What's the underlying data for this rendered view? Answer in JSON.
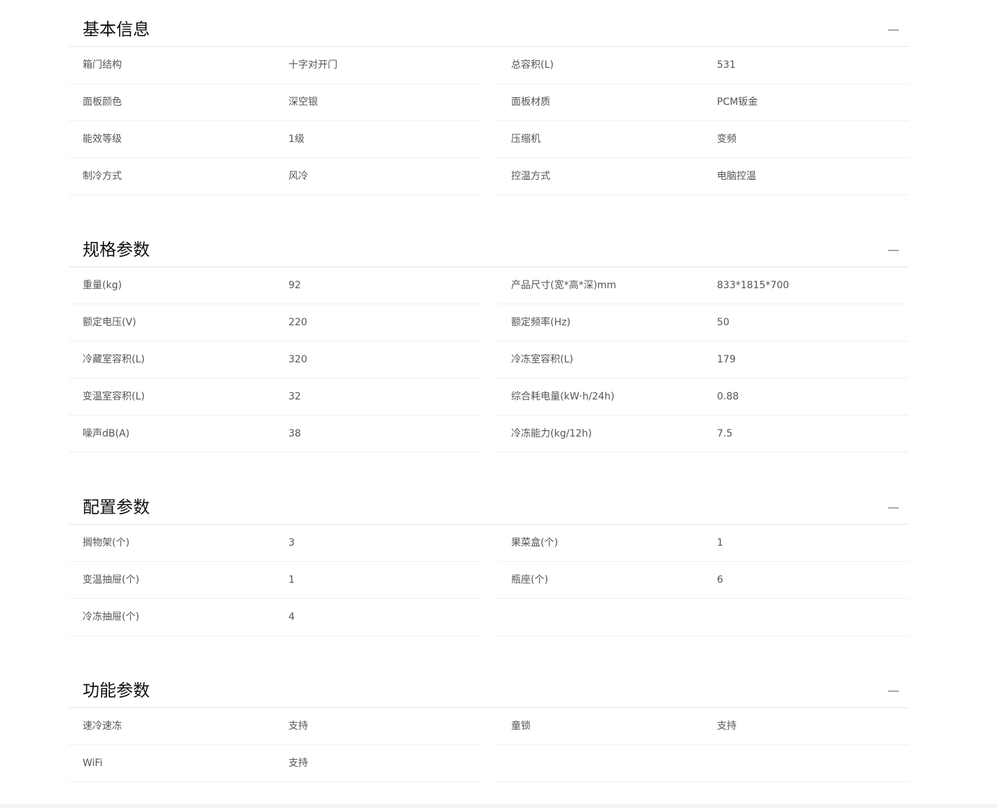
{
  "sections": [
    {
      "title": "基本信息",
      "rows": [
        [
          "箱门结构",
          "十字对开门",
          "总容积(L)",
          "531"
        ],
        [
          "面板颜色",
          "深空银",
          "面板材质",
          "PCM钣金"
        ],
        [
          "能效等级",
          "1级",
          "压缩机",
          "变频"
        ],
        [
          "制冷方式",
          "风冷",
          "控温方式",
          "电脑控温"
        ]
      ]
    },
    {
      "title": "规格参数",
      "rows": [
        [
          "重量(kg)",
          "92",
          "产品尺寸(宽*高*深)mm",
          "833*1815*700"
        ],
        [
          "额定电压(V)",
          "220",
          "额定频率(Hz)",
          "50"
        ],
        [
          "冷藏室容积(L)",
          "320",
          "冷冻室容积(L)",
          "179"
        ],
        [
          "变温室容积(L)",
          "32",
          "综合耗电量(kW·h/24h)",
          "0.88"
        ],
        [
          "噪声dB(A)",
          "38",
          "冷冻能力(kg/12h)",
          "7.5"
        ]
      ]
    },
    {
      "title": "配置参数",
      "rows": [
        [
          "搁物架(个)",
          "3",
          "果菜盒(个)",
          "1"
        ],
        [
          "变温抽屉(个)",
          "1",
          "瓶座(个)",
          "6"
        ],
        [
          "冷冻抽屉(个)",
          "4",
          "",
          ""
        ]
      ]
    },
    {
      "title": "功能参数",
      "rows": [
        [
          "速冷速冻",
          "支持",
          "童锁",
          "支持"
        ],
        [
          "WiFi",
          "支持",
          "",
          ""
        ]
      ]
    }
  ]
}
